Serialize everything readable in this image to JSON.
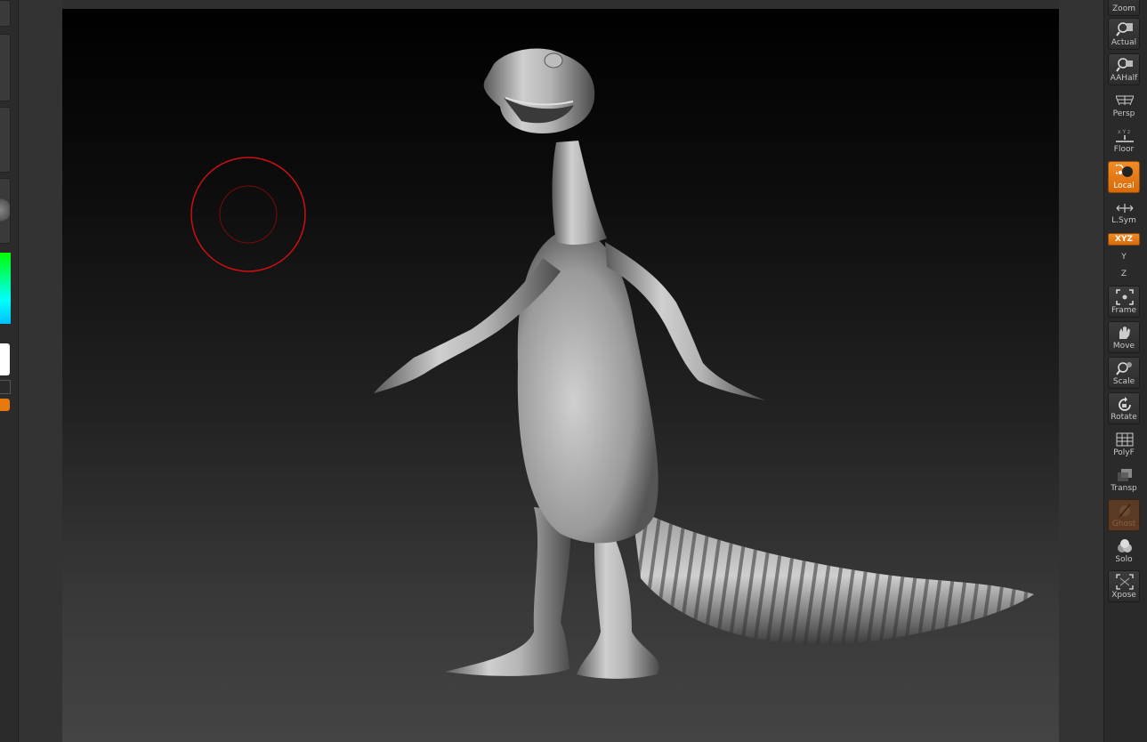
{
  "right_shelf": {
    "zoom": "Zoom",
    "actual": "Actual",
    "aahalf": "AAHalf",
    "persp": "Persp",
    "floor": "Floor",
    "local": "Local",
    "lsym": "L.Sym",
    "xyz": "XYZ",
    "y_axis": "Y",
    "z_axis": "Z",
    "frame": "Frame",
    "move": "Move",
    "scale": "Scale",
    "rotate": "Rotate",
    "polyf": "PolyF",
    "transp": "Transp",
    "ghost": "Ghost",
    "solo": "Solo",
    "xpose": "Xpose"
  },
  "colors": {
    "accent_orange": "#f08c28",
    "brush_cursor": "#cc1010",
    "canvas_top": "#000000",
    "canvas_bottom": "#444444"
  },
  "icons": [
    "zoom-icon",
    "actual-icon",
    "aahalf-icon",
    "persp-icon",
    "floor-icon",
    "local-icon",
    "lsym-icon",
    "frame-icon",
    "move-icon",
    "scale-icon",
    "rotate-icon",
    "polyf-icon",
    "transp-icon",
    "ghost-icon",
    "solo-icon",
    "xpose-icon"
  ]
}
